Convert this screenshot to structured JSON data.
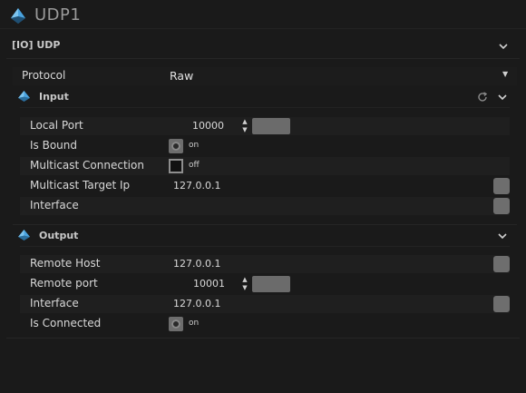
{
  "window": {
    "title": "UDP1"
  },
  "section": {
    "label": "[IO] UDP"
  },
  "protocol": {
    "label": "Protocol",
    "value": "Raw"
  },
  "input": {
    "label": "Input",
    "local_port": {
      "label": "Local Port",
      "value": "10000"
    },
    "is_bound": {
      "label": "Is Bound",
      "state": "on"
    },
    "multicast_connection": {
      "label": "Multicast Connection",
      "state": "off"
    },
    "multicast_target_ip": {
      "label": "Multicast Target Ip",
      "value": "127.0.0.1"
    },
    "interface": {
      "label": "Interface",
      "value": ""
    }
  },
  "output": {
    "label": "Output",
    "remote_host": {
      "label": "Remote Host",
      "value": "127.0.0.1"
    },
    "remote_port": {
      "label": "Remote port",
      "value": "10001"
    },
    "interface": {
      "label": "Interface",
      "value": "127.0.0.1"
    },
    "is_connected": {
      "label": "Is Connected",
      "state": "on"
    }
  },
  "colors": {
    "background": "#1a1a1a",
    "accent": "#4aa3df",
    "control": "#6e6e6e"
  },
  "icons": [
    "module-logo-icon",
    "chevron-down-icon",
    "reset-icon",
    "caret-down-icon",
    "spin-up-icon",
    "spin-down-icon"
  ]
}
